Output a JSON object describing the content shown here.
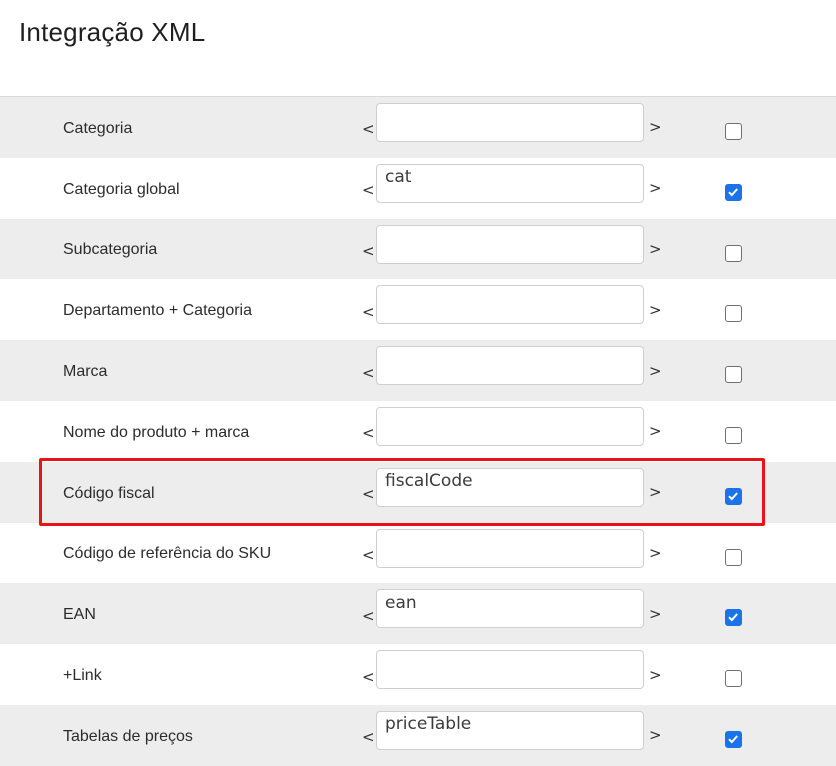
{
  "header": {
    "title": "Integração XML"
  },
  "brackets": {
    "open": "<",
    "close": ">"
  },
  "rows": [
    {
      "label": "Categoria",
      "value": "",
      "checked": false
    },
    {
      "label": "Categoria global",
      "value": "cat",
      "checked": true
    },
    {
      "label": "Subcategoria",
      "value": "",
      "checked": false
    },
    {
      "label": "Departamento + Categoria",
      "value": "",
      "checked": false
    },
    {
      "label": "Marca",
      "value": "",
      "checked": false
    },
    {
      "label": "Nome do produto + marca",
      "value": "",
      "checked": false
    },
    {
      "label": "Código fiscal",
      "value": "fiscalCode",
      "checked": true
    },
    {
      "label": "Código de referência do SKU",
      "value": "",
      "checked": false
    },
    {
      "label": "EAN",
      "value": "ean",
      "checked": true
    },
    {
      "label": "+Link",
      "value": "",
      "checked": false
    },
    {
      "label": "Tabelas de preços",
      "value": "priceTable",
      "checked": true
    }
  ],
  "colors": {
    "accent": "#1a73e8",
    "highlight": "#e8141b",
    "row_shade": "#ededed"
  }
}
